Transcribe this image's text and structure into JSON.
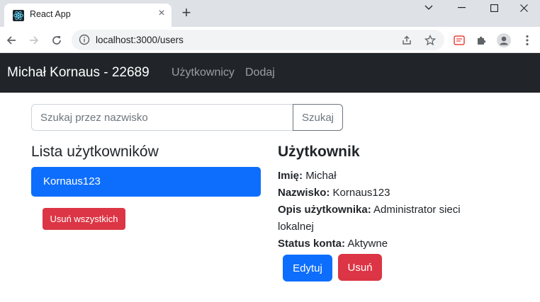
{
  "browser": {
    "tab_title": "React App",
    "url": "localhost:3000/users",
    "icons": {
      "favicon": "react-logo-icon",
      "tab_close": "close-icon",
      "new_tab": "plus-icon",
      "back": "arrow-left-icon",
      "forward": "arrow-right-icon",
      "reload": "reload-icon",
      "site_info": "info-icon",
      "share": "share-icon",
      "bookmark": "star-icon",
      "extension": "extension-icon",
      "extensions_menu": "puzzle-icon",
      "profile": "profile-icon",
      "menu": "kebab-menu-icon",
      "minimize": "minimize-icon",
      "maximize": "maximize-icon",
      "close_window": "close-icon",
      "tab_search": "chevron-down-icon"
    }
  },
  "navbar": {
    "brand": "Michał Kornaus - 22689",
    "links": [
      "Użytkownicy",
      "Dodaj"
    ]
  },
  "search": {
    "placeholder": "Szukaj przez nazwisko",
    "value": "",
    "button_label": "Szukaj"
  },
  "user_list": {
    "heading": "Lista użytkowników",
    "items": [
      "Kornaus123"
    ],
    "remove_all_label": "Usuń wszystkich"
  },
  "user_detail": {
    "heading": "Użytkownik",
    "fields": [
      {
        "label": "Imię:",
        "value": "Michał"
      },
      {
        "label": "Nazwisko:",
        "value": "Kornaus123"
      },
      {
        "label": "Opis użytkownika:",
        "value": "Administrator sieci lokalnej"
      },
      {
        "label": "Status konta:",
        "value": "Aktywne"
      }
    ],
    "edit_label": "Edytuj",
    "delete_label": "Usuń"
  },
  "colors": {
    "navbar": "#212529",
    "primary": "#0d6efd",
    "danger": "#dc3545",
    "secondary": "#6c757d"
  }
}
